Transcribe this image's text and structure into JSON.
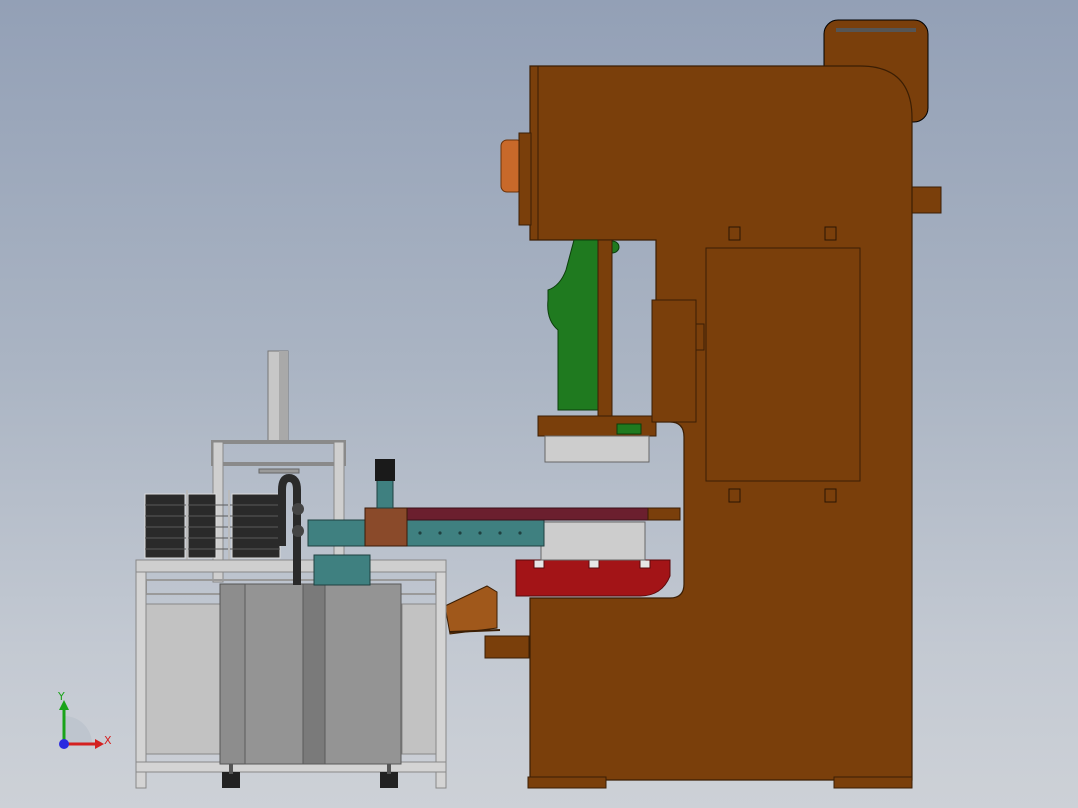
{
  "colors": {
    "press_body": "#7a3f0b",
    "press_edge": "#3b1e04",
    "bolster": "#a31417",
    "slide": "#1f7a1f",
    "flywheel": "#1b1b1b",
    "copper": "#c8692a",
    "cabinet_gray": "#8d8d8d",
    "frame_light": "#cfcfcf",
    "feeder_teal": "#3f8080",
    "feed_belt": "#6b1f2e",
    "triad_x": "#d42020",
    "triad_y": "#19a319",
    "triad_z": "#2a2ae0"
  },
  "icons": {
    "triad": "xyz-axis-triad-icon"
  },
  "triad": {
    "x_label": "X",
    "y_label": "Y"
  }
}
